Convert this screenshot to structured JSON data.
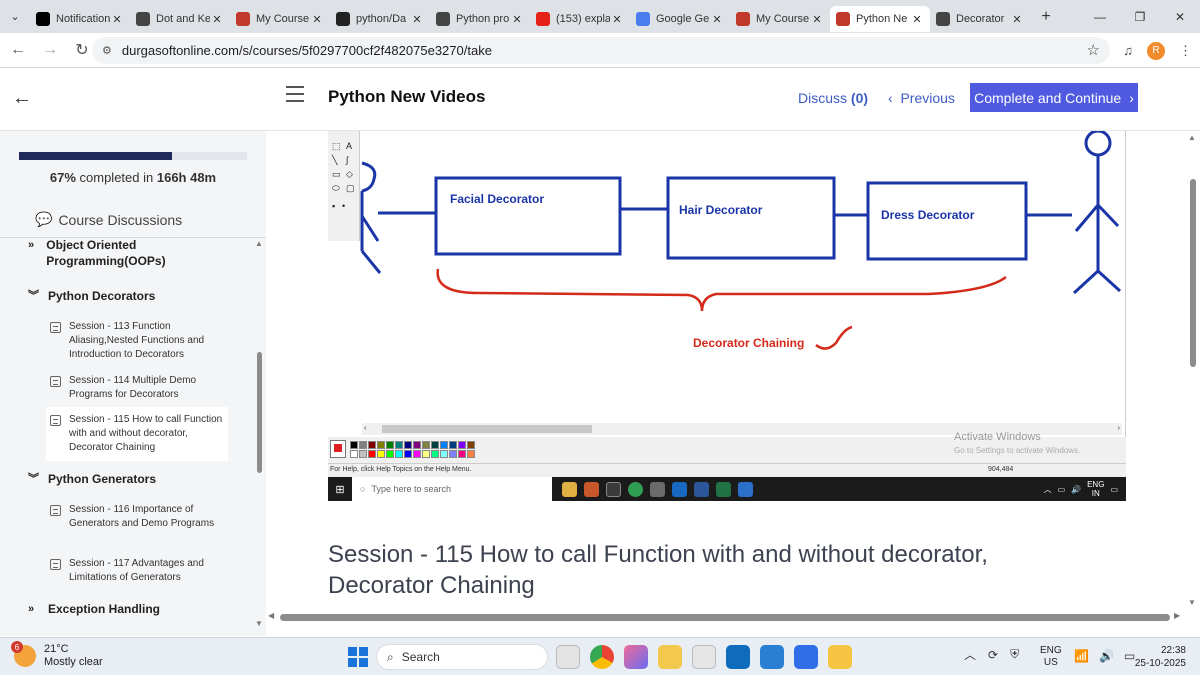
{
  "browser": {
    "tabs": [
      {
        "label": "Notification",
        "favicon": "x-icon",
        "color": "#000000"
      },
      {
        "label": "Dot and Ke",
        "favicon": "chatgpt-icon",
        "color": "#444444"
      },
      {
        "label": "My Course",
        "favicon": "durgasoft-icon",
        "color": "#c0392b"
      },
      {
        "label": "python/Da",
        "favicon": "github-icon",
        "color": "#222222"
      },
      {
        "label": "Python pro",
        "favicon": "chatgpt-icon",
        "color": "#444444"
      },
      {
        "label": "(153) expla",
        "favicon": "youtube-icon",
        "color": "#e62117"
      },
      {
        "label": "Google Ge",
        "favicon": "gemini-icon",
        "color": "#4a7cf0"
      },
      {
        "label": "My Course",
        "favicon": "durgasoft-icon",
        "color": "#c0392b"
      },
      {
        "label": "Python Ne",
        "favicon": "durgasoft-icon",
        "color": "#c0392b",
        "active": true
      },
      {
        "label": "Decorator",
        "favicon": "chatgpt-icon",
        "color": "#444444"
      }
    ],
    "url": "durgasoftonline.com/s/courses/5f0297700cf2f482075e3270/take",
    "profile_initial": "R"
  },
  "header": {
    "course_title": "Python New Videos",
    "discuss_label": "Discuss",
    "discuss_count": "(0)",
    "previous_label": "Previous",
    "complete_label": "Complete and Continue"
  },
  "sidebar": {
    "progress_percent": 67,
    "progress_percent_label": "67%",
    "progress_completed_text": "completed in",
    "progress_time": "166h 48m",
    "discussions_label": "Course Discussions",
    "sections": [
      {
        "title": "Object Oriented Programming(OOPs)",
        "expanded": false
      },
      {
        "title": "Python Decorators",
        "expanded": true,
        "lessons": [
          "Session - 113 Function Aliasing,Nested Functions and Introduction to Decorators",
          "Session - 114 Multiple Demo Programs for Decorators",
          "Session - 115 How to call Function with and without decorator, Decorator Chaining"
        ]
      },
      {
        "title": "Python Generators",
        "expanded": true,
        "lessons": [
          "Session - 116 Importance of Generators and Demo Programs",
          "Session - 117 Advantages and Limitations of Generators"
        ]
      },
      {
        "title": "Exception Handling",
        "expanded": false
      }
    ]
  },
  "video": {
    "boxes": [
      "Facial Decorator",
      "Hair Decorator",
      "Dress Decorator"
    ],
    "chaining_label": "Decorator Chaining",
    "paint_status": "For Help, click Help Topics on the Help Menu.",
    "paint_coords": "904,484",
    "activate_title": "Activate Windows",
    "activate_sub": "Go to Settings to activate Windows.",
    "inner_search_placeholder": "Type here to search",
    "inner_lang": "ENG",
    "inner_region": "IN"
  },
  "lesson_title": "Session - 115 How to call Function with and without decorator, Decorator Chaining",
  "taskbar": {
    "temperature": "21°C",
    "weather": "Mostly clear",
    "weather_badge": "6",
    "search_label": "Search",
    "lang": "ENG",
    "region": "US",
    "time": "22:38",
    "date": "25-10-2025"
  },
  "colors": {
    "accent": "#4f5ae0",
    "link": "#3c5ec3",
    "progress": "#202a5c",
    "diagram_blue": "#1a35a8",
    "diagram_red": "#d42a1a"
  }
}
